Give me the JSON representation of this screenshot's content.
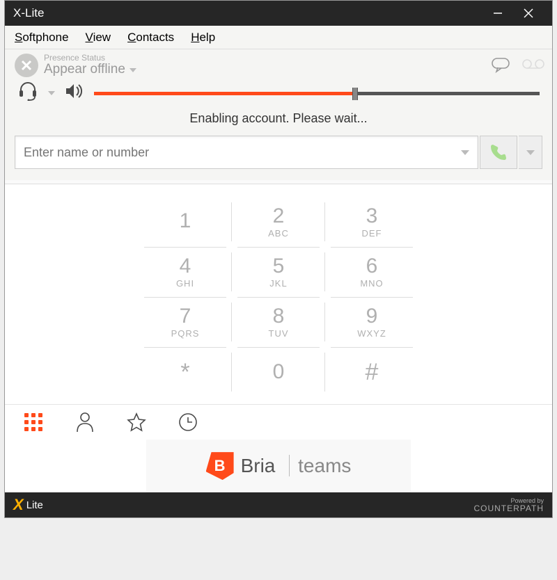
{
  "window": {
    "title": "X-Lite"
  },
  "menu": {
    "items": [
      "Softphone",
      "View",
      "Contacts",
      "Help"
    ]
  },
  "presence": {
    "label": "Presence Status",
    "value": "Appear offline"
  },
  "volume": {
    "percent": 58
  },
  "status": "Enabling account. Please wait...",
  "search": {
    "placeholder": "Enter name or number",
    "value": ""
  },
  "dialpad": {
    "keys": [
      {
        "n": "1",
        "l": ""
      },
      {
        "n": "2",
        "l": "ABC"
      },
      {
        "n": "3",
        "l": "DEF"
      },
      {
        "n": "4",
        "l": "GHI"
      },
      {
        "n": "5",
        "l": "JKL"
      },
      {
        "n": "6",
        "l": "MNO"
      },
      {
        "n": "7",
        "l": "PQRS"
      },
      {
        "n": "8",
        "l": "TUV"
      },
      {
        "n": "9",
        "l": "WXYZ"
      },
      {
        "n": "*",
        "l": ""
      },
      {
        "n": "0",
        "l": ""
      },
      {
        "n": "#",
        "l": ""
      }
    ]
  },
  "ad": {
    "brand": "Bria",
    "sub": "teams"
  },
  "footer": {
    "brand": "Lite",
    "powered_label": "Powered by",
    "powered_by": "COUNTERPATH"
  }
}
